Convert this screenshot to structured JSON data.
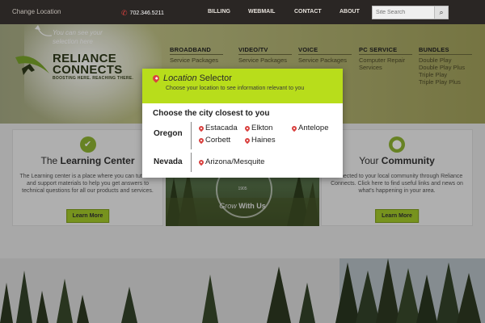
{
  "topbar": {
    "change_location": "Change Location",
    "phone": "702.346.5211",
    "nav": [
      {
        "label": "BILLING"
      },
      {
        "label": "WEBMAIL"
      },
      {
        "label": "CONTACT"
      },
      {
        "label": "ABOUT"
      }
    ],
    "search_placeholder": "Site Search"
  },
  "hero": {
    "note": "You can see your selection here",
    "logo_line1": "RELIANCE",
    "logo_line2": "CONNECTS",
    "logo_tag": "BOOSTING HERE. REACHING THERE.",
    "menu": [
      {
        "head": "BROADBAND",
        "items": [
          "Service Packages"
        ]
      },
      {
        "head": "VIDEO/TV",
        "items": [
          "Service Packages"
        ]
      },
      {
        "head": "VOICE",
        "items": [
          "Service Packages"
        ]
      },
      {
        "head": "PC SERVICE",
        "items": [
          "Computer Repair",
          "Services"
        ]
      },
      {
        "head": "BUNDLES",
        "items": [
          "Double Play",
          "Double Play Plus",
          "Triple Play",
          "Triple Play Plus"
        ]
      }
    ]
  },
  "cards": {
    "learning": {
      "title_pre": "The ",
      "title_bold": "Learning Center",
      "desc": "The Learning center is a place where you can tutorials and support materials to help you get answers to technical questions for all our products and services.",
      "button": "Learn More"
    },
    "middle": {
      "year": "1905",
      "grow": "Grow",
      "with_us": " With Us"
    },
    "community": {
      "title_pre": "Your ",
      "title_bold": "Community",
      "desc": "connected to your local community through Reliance Connects. Click here to find useful links and news on what's happening in your area.",
      "button": "Learn More"
    }
  },
  "modal": {
    "title_italic": "Location",
    "title_rest": " Selector",
    "subtitle": "Choose your location to see information relevant to you",
    "prompt": "Choose the city closest to you",
    "states": [
      {
        "name": "Oregon",
        "cities": [
          "Estacada",
          "Elkton",
          "Antelope",
          "Corbett",
          "Haines"
        ]
      },
      {
        "name": "Nevada",
        "cities": [
          "Arizona/Mesquite"
        ]
      }
    ]
  },
  "colors": {
    "accent_green": "#b8dd1b",
    "pin_red": "#d9413f",
    "topbar": "#2a2624"
  }
}
